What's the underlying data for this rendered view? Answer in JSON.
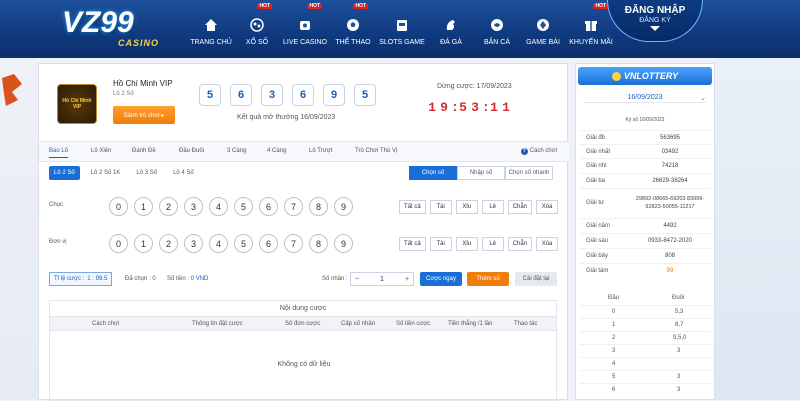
{
  "header": {
    "logo_main": "VZ99",
    "logo_sub": "CASINO",
    "nav": [
      {
        "label": "TRANG CHỦ",
        "hot": ""
      },
      {
        "label": "XỔ SỐ",
        "hot": "HOT"
      },
      {
        "label": "LIVE CASINO",
        "hot": "HOT"
      },
      {
        "label": "THỂ THAO",
        "hot": "HOT"
      },
      {
        "label": "SLOTS GAME",
        "hot": ""
      },
      {
        "label": "ĐÁ GÀ",
        "hot": ""
      },
      {
        "label": "BẮN CÁ",
        "hot": ""
      },
      {
        "label": "GAME BÀI",
        "hot": ""
      },
      {
        "label": "KHUYẾN MÃI",
        "hot": "HOT"
      }
    ],
    "login_label": "ĐĂNG NHẬP",
    "register_label": "ĐĂNG KÝ"
  },
  "game": {
    "badge_text": "Hồ Chí Minh VIP",
    "name": "Hồ Chí Minh VIP",
    "type": "Lô 2 Số",
    "lobby_button": "Sảnh trò chơi ▸",
    "result_balls": [
      "5",
      "6",
      "3",
      "6",
      "9",
      "5"
    ],
    "result_text": "Kết quả mở thưởng 16/09/2023",
    "countdown_label": "Dừng cược: 17/09/2023",
    "countdown": [
      "1",
      "9",
      ":",
      "5",
      "3",
      ":",
      "1",
      "1"
    ]
  },
  "tabs": [
    "Bao Lô",
    "Lô Xiên",
    "Đánh Đề",
    "Đầu Đuôi",
    "3 Càng",
    "4 Càng",
    "Lô Trượt",
    "Trò Chơi Thú Vị"
  ],
  "guide_label": "Cách chơi",
  "subtabs": [
    "Lô 2 Số",
    "Lô 2 Số 1K",
    "Lô 3 Số",
    "Lô 4 Số"
  ],
  "modes": [
    "Chọn số",
    "Nhập số",
    "Chọn số nhanh"
  ],
  "rows": [
    {
      "label": "Chục"
    },
    {
      "label": "Đơn vị"
    }
  ],
  "digits": [
    "0",
    "1",
    "2",
    "3",
    "4",
    "5",
    "6",
    "7",
    "8",
    "9"
  ],
  "quick": [
    "Tất cả",
    "Tài",
    "Xỉu",
    "Lẻ",
    "Chẵn",
    "Xóa"
  ],
  "betbar": {
    "odds_label": "Tỉ lệ cược :",
    "odds_value": "1 : 99.5",
    "chosen_label": "Đã chọn :",
    "chosen_value": "0",
    "amount_label": "Số tiền :",
    "amount_value": "0 VND",
    "multiplier_label": "Số nhân :",
    "multiplier_value": "1",
    "bet_now": "Cược ngay",
    "add_bet": "Thêm số",
    "reset": "Cài đặt lại"
  },
  "table": {
    "title": "Nội dung cược",
    "headers": [
      "Cách chơi",
      "Thông tin đặt cược",
      "Số đơn cược",
      "Cấp số nhân",
      "Số tiền cược",
      "Tiền thắng /1 lần",
      "Thao tác"
    ],
    "empty": "Không có dữ liệu"
  },
  "sidebar": {
    "brand": "VNLOTTERY",
    "date": "16/09/2023",
    "ky": "Kỳ số 16/09/2023",
    "prizes": [
      {
        "name": "Giải đb",
        "value": "563695"
      },
      {
        "name": "Giải nhất",
        "value": "03492"
      },
      {
        "name": "Giải nhì",
        "value": "74218"
      },
      {
        "name": "Giải ba",
        "value": "26629-38264"
      },
      {
        "name": "Giải tư",
        "value": "29892-08665-69203 83999-92823-50055-11217"
      },
      {
        "name": "Giải năm",
        "value": "4492"
      },
      {
        "name": "Giải sáu",
        "value": "0933-8472-2020"
      },
      {
        "name": "Giải bảy",
        "value": "808"
      },
      {
        "name": "Giải tám",
        "value": "99"
      }
    ],
    "dau_header": "Đầu",
    "duoi_header": "Đuôi",
    "dau_rows": [
      {
        "dau": "0",
        "duoi": "5,3"
      },
      {
        "dau": "1",
        "duoi": "8,7"
      },
      {
        "dau": "2",
        "duoi": "9,5,0"
      },
      {
        "dau": "3",
        "duoi": "3"
      },
      {
        "dau": "4",
        "duoi": ""
      },
      {
        "dau": "5",
        "duoi": "3"
      },
      {
        "dau": "6",
        "duoi": "3"
      }
    ]
  }
}
